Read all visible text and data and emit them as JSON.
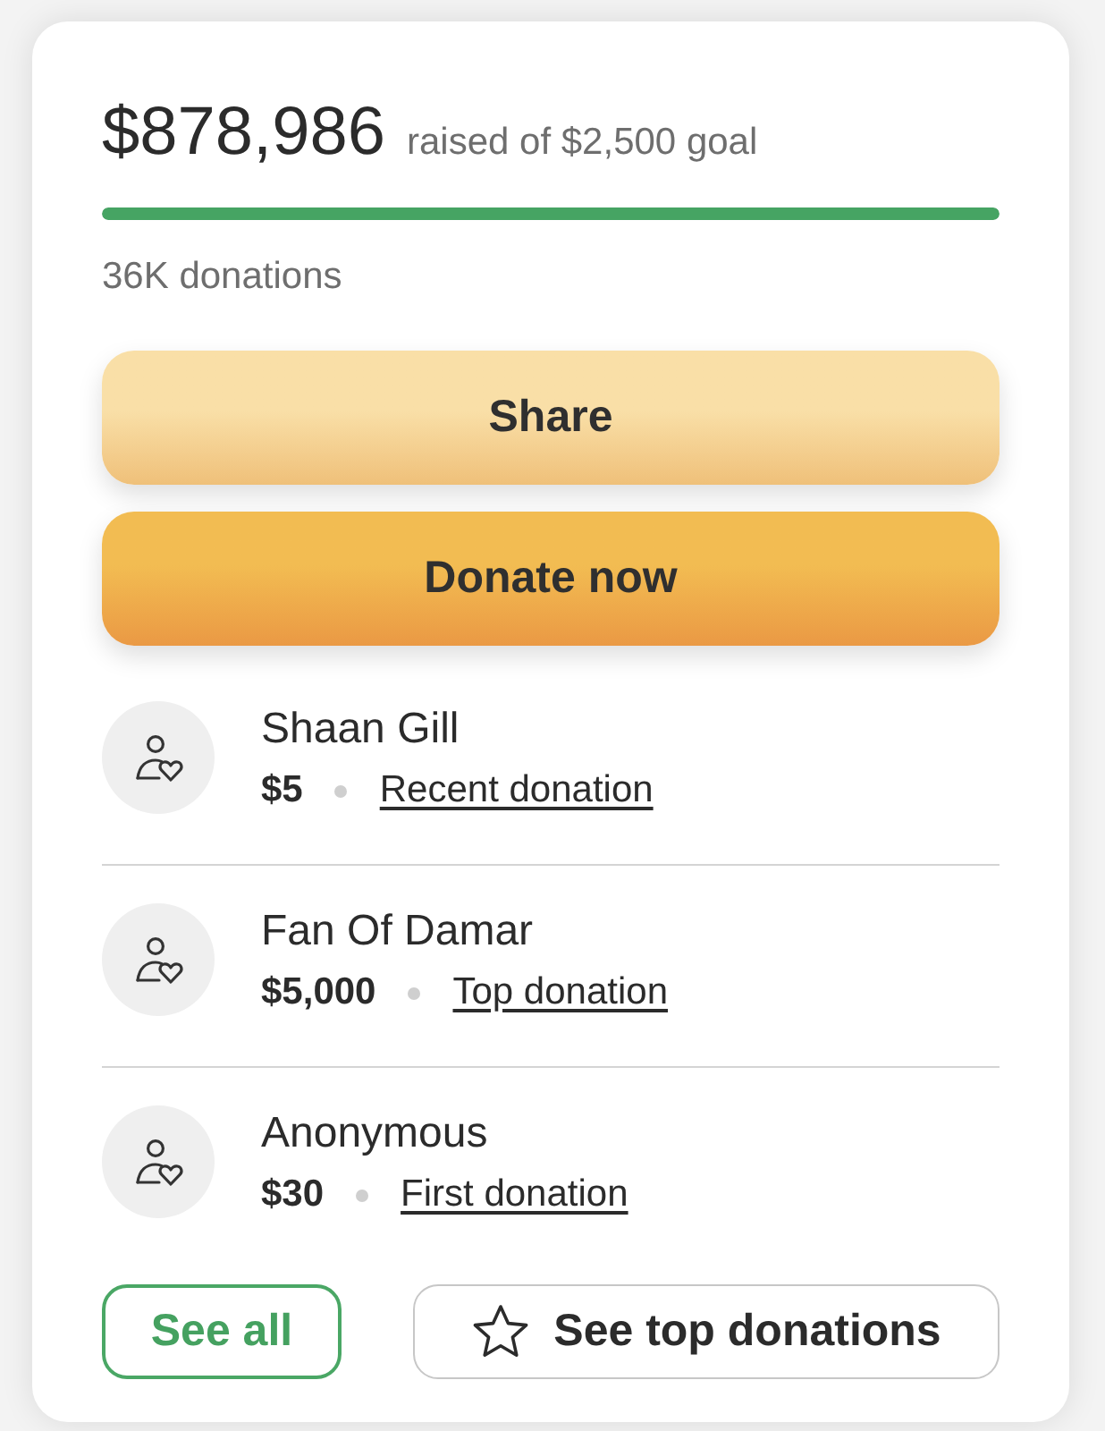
{
  "summary": {
    "raised": "$878,986",
    "goal_text": "raised of $2,500 goal",
    "level": 1,
    "donations_count": "36K donations"
  },
  "actions": [
    {
      "label": "Share",
      "kind": "light"
    },
    {
      "label": "Donate now",
      "kind": "strong"
    }
  ],
  "donations": [
    {
      "name": "Shaan Gill",
      "amount": "$5",
      "link": "Recent donation"
    },
    {
      "name": "Fan Of Damar",
      "amount": "$5,000",
      "link": "Top donation"
    },
    {
      "name": "Anonymous",
      "amount": "$30",
      "link": "First donation"
    }
  ],
  "footer_buttons": [
    {
      "label": "See all",
      "kind": "outline"
    },
    {
      "label": "See top donations",
      "kind": "starred"
    }
  ]
}
